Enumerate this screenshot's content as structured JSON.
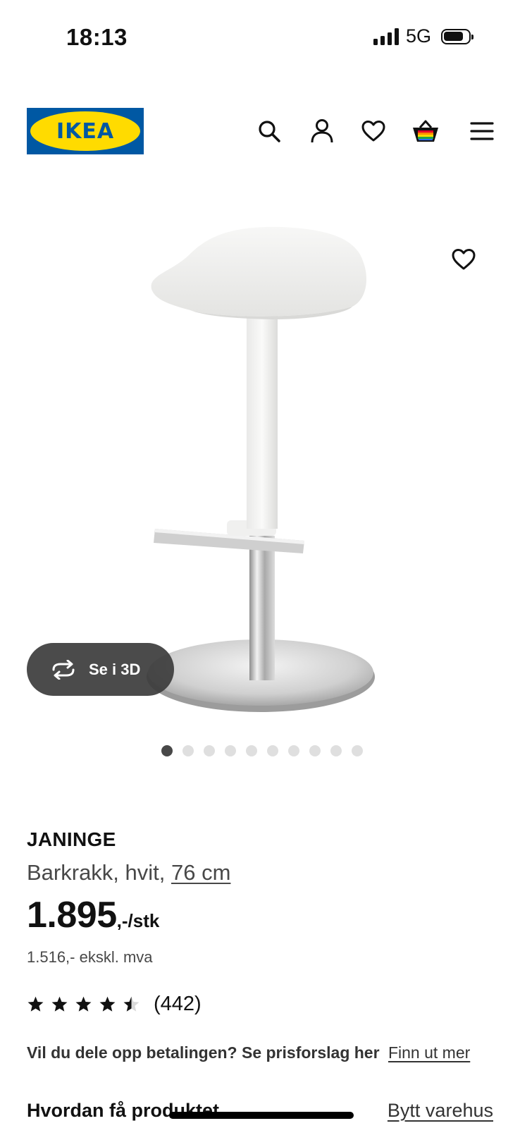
{
  "status_bar": {
    "time": "18:13",
    "network": "5G"
  },
  "header": {
    "logo_text": "IKEA",
    "icons": [
      "search-icon",
      "profile-icon",
      "heart-icon",
      "cart-icon",
      "menu-icon"
    ],
    "colors": {
      "logo_blue": "#0058a3",
      "logo_yellow": "#ffdb00"
    }
  },
  "gallery": {
    "view3d_label": "Se i 3D",
    "total_images": 10,
    "active_index": 0
  },
  "product": {
    "name": "JANINGE",
    "description": "Barkrakk, hvit,",
    "size_link": "76 cm",
    "price": "1.895",
    "price_unit": ",-/stk",
    "price_ex_vat": "1.516,- ekskl. mva",
    "rating_value": 4.5,
    "rating_max": 5,
    "review_count": "(442)"
  },
  "payment": {
    "text": "Vil du dele opp betalingen? Se prisforslag her",
    "link": "Finn ut mer"
  },
  "delivery": {
    "heading": "Hvordan få produktet",
    "change_store": "Bytt varehus"
  }
}
